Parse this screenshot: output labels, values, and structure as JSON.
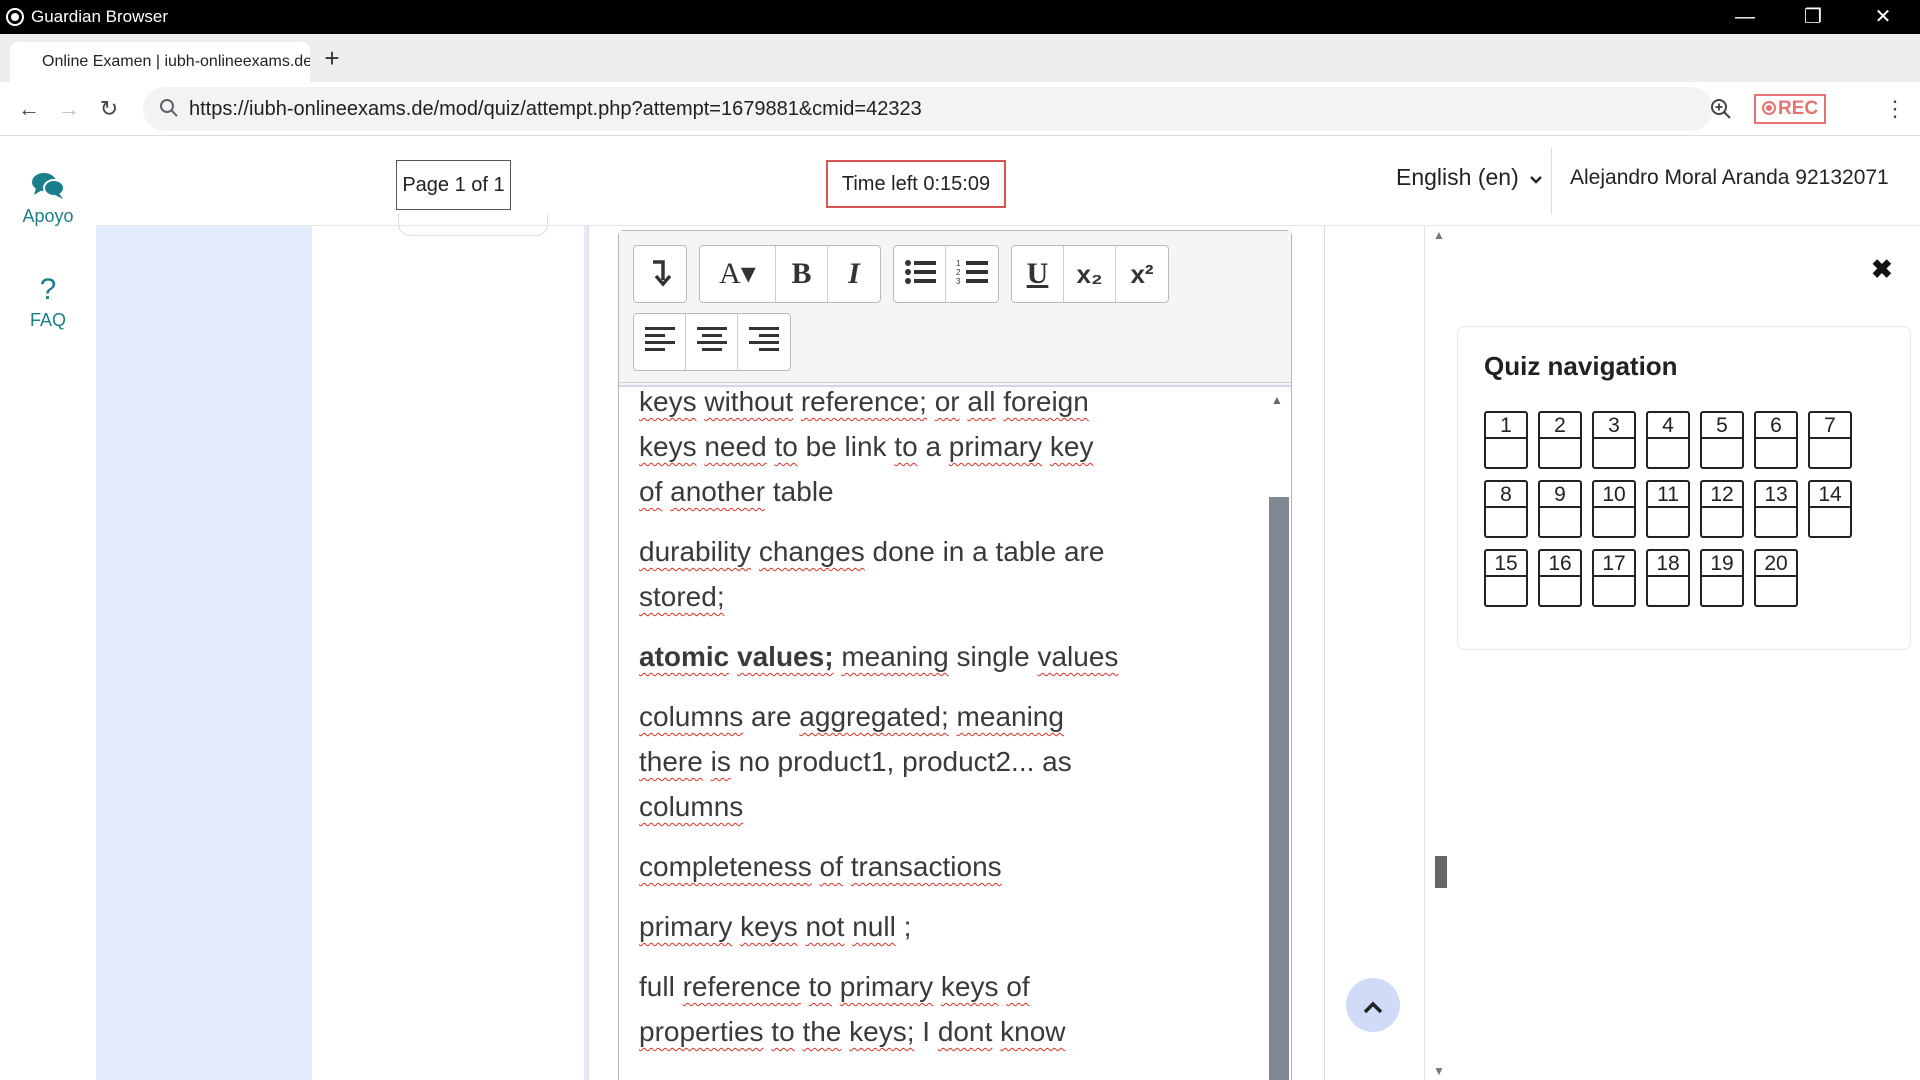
{
  "window": {
    "title": "Guardian Browser",
    "min_label": "—",
    "max_label": "❐",
    "close_label": "✕"
  },
  "tabs": [
    {
      "label": "Online Examen | iubh-onlineexams.de"
    }
  ],
  "new_tab_label": "+",
  "navbar": {
    "back": "←",
    "forward": "→",
    "reload": "↻",
    "url": "https://iubh-onlineexams.de/mod/quiz/attempt.php?attempt=1679881&cmid=42323",
    "rec_label": "REC",
    "more": "⋮"
  },
  "sidenav": {
    "items": [
      {
        "label": "Apoyo",
        "icon": "chat-bubbles-icon"
      },
      {
        "label": "FAQ",
        "icon": "question-icon",
        "glyph": "?"
      }
    ]
  },
  "header": {
    "page_indicator": "Page 1 of 1",
    "timer": "Time left 0:15:09",
    "language": "English (en)",
    "user": "Alejandro Moral Aranda 92132071"
  },
  "editor": {
    "toolbar": {
      "row1": [
        {
          "name": "toggle-toolbar",
          "icon": "arrow-down-icon"
        },
        {
          "name": "font-size",
          "glyph": "A▾",
          "icon": "font-size-icon"
        },
        {
          "name": "bold",
          "glyph": "B",
          "icon": "bold-icon"
        },
        {
          "name": "italic",
          "glyph": "I",
          "icon": "italic-icon"
        },
        {
          "name": "unordered-list",
          "icon": "bullet-list-icon"
        },
        {
          "name": "ordered-list",
          "icon": "numbered-list-icon"
        },
        {
          "name": "underline",
          "glyph": "U",
          "icon": "underline-icon"
        },
        {
          "name": "subscript",
          "glyph": "x₂",
          "icon": "subscript-icon"
        },
        {
          "name": "superscript",
          "glyph": "x²",
          "icon": "superscript-icon"
        }
      ],
      "row2": [
        {
          "name": "align-left",
          "icon": "align-left-icon"
        },
        {
          "name": "align-center",
          "icon": "align-center-icon"
        },
        {
          "name": "align-right",
          "icon": "align-right-icon"
        }
      ]
    },
    "content": {
      "p1": {
        "w1": "keys",
        "w2": "without",
        "w3": "reference;",
        "w4": "or",
        "w5": "all",
        "w6": "foreign",
        "w7": "keys",
        "w8": "need",
        "w9": "to",
        "w10": "be link",
        "w11": "to",
        "w12": "a",
        "w13": "primary",
        "w14": "key",
        "w15": "of",
        "w16": "another",
        "w17": "table"
      },
      "p2": {
        "w1": "durability",
        "w2": "changes",
        "w3": "done in a table are",
        "w4": "stored;"
      },
      "p3": {
        "w1": "atomic",
        "w2": "values;",
        "w3": "meaning",
        "w4": "single",
        "w5": "values"
      },
      "p4": {
        "w1": "columns",
        "w2": "are",
        "w3": "aggregated;",
        "w4": "meaning",
        "w5": "there",
        "w6": "is",
        "w7": "no product1, product2... as",
        "w8": "columns"
      },
      "p5": {
        "w1": "completeness",
        "w2": "of",
        "w3": "transactions"
      },
      "p6": {
        "w1": "primary",
        "w2": "keys",
        "w3": "not",
        "w4": "null",
        "w5": ";"
      },
      "p7": {
        "w1": "full",
        "w2": "reference",
        "w3": "to",
        "w4": "primary",
        "w5": "keys",
        "w6": "of",
        "w7": "properties",
        "w8": "to",
        "w9": "the",
        "w10": "keys;",
        "w11": "I",
        "w12": "dont",
        "w13": "know"
      }
    }
  },
  "back_to_top": "⌃",
  "drawer": {
    "close": "✖",
    "title": "Quiz navigation",
    "questions": [
      "1",
      "2",
      "3",
      "4",
      "5",
      "6",
      "7",
      "8",
      "9",
      "10",
      "11",
      "12",
      "13",
      "14",
      "15",
      "16",
      "17",
      "18",
      "19",
      "20"
    ]
  }
}
